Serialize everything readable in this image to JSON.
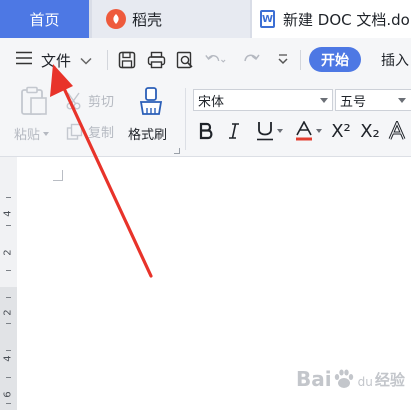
{
  "tabs": {
    "home": "首页",
    "daoke": "稻壳",
    "document": "新建 DOC 文档.do"
  },
  "toolbar": {
    "file_menu": "文件",
    "start_tab": "开始",
    "insert_tab": "插入"
  },
  "ribbon": {
    "paste": "粘贴",
    "cut": "剪切",
    "copy": "复制",
    "format_painter": "格式刷",
    "font_name": "宋体",
    "font_size": "五号",
    "superscript": "X²",
    "subscript": "X₂"
  },
  "ruler": {
    "numbers": [
      "4",
      "2",
      "2",
      "4",
      "6"
    ]
  },
  "watermark": {
    "text_left": "Bai",
    "text_right": "经验",
    "text_sub": "du"
  },
  "colors": {
    "accent": "#4d78e4",
    "arrow": "#e8332a",
    "daoke_logo": "#ee5a3c"
  },
  "icons": [
    "menu-icon",
    "save-icon",
    "print-icon",
    "print-preview-icon",
    "undo-icon",
    "redo-icon",
    "more-icon",
    "paste-icon",
    "cut-icon",
    "copy-icon",
    "format-painter-icon",
    "underline-dropdown-icon",
    "font-color-icon"
  ]
}
